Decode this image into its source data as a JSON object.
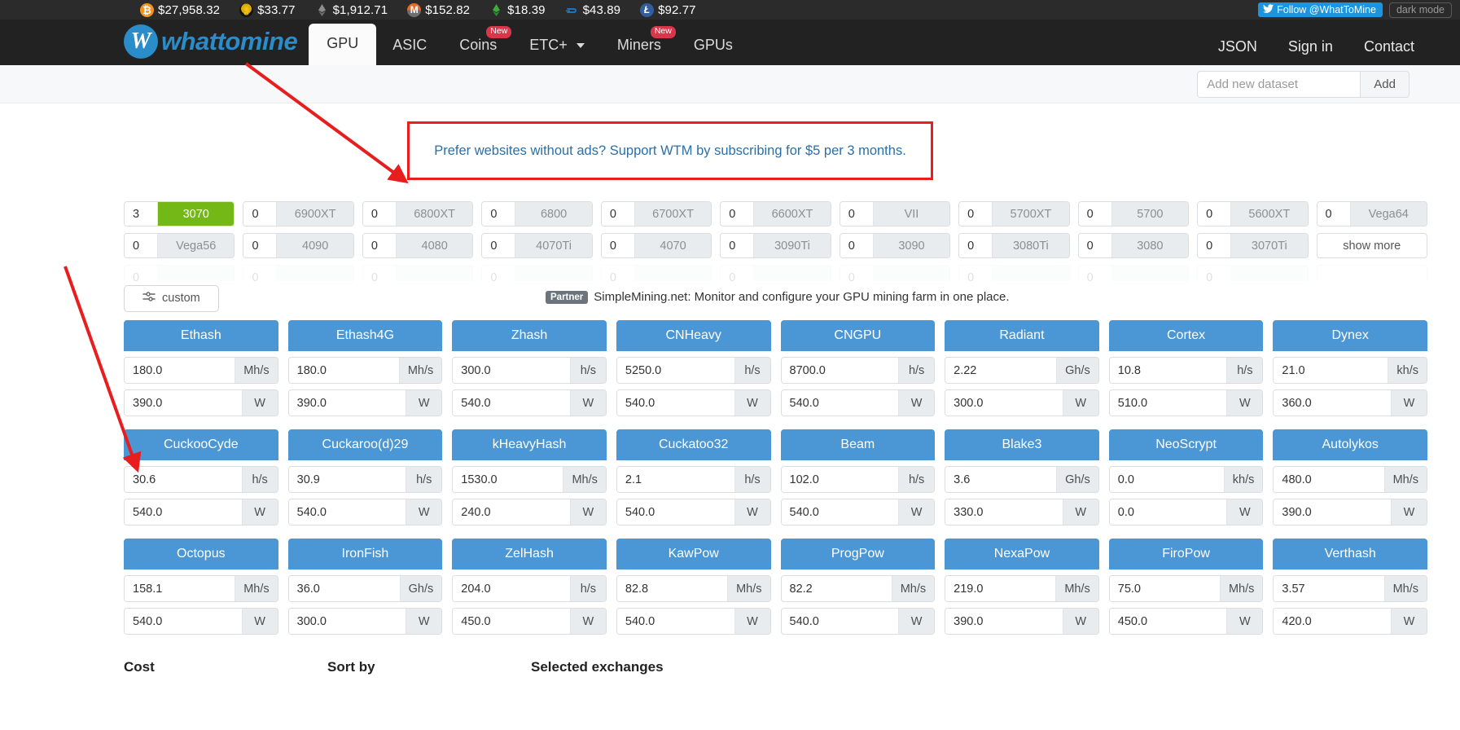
{
  "ticker": {
    "coins": [
      {
        "symbol": "BTC",
        "glyph": "₿",
        "icon": "bitcoin-icon",
        "price": "$27,958.32"
      },
      {
        "symbol": "ETC",
        "glyph": "ƺ",
        "icon": "ethereum-classic-icon",
        "price": "$33.77"
      },
      {
        "symbol": "ETH",
        "glyph": "",
        "icon": "ethereum-icon",
        "price": "$1,912.71"
      },
      {
        "symbol": "XMR",
        "glyph": "M",
        "icon": "monero-icon",
        "price": "$152.82"
      },
      {
        "symbol": "ETHW",
        "glyph": "",
        "icon": "ethereum-pow-icon",
        "price": "$18.39"
      },
      {
        "symbol": "DASH",
        "glyph": "D",
        "icon": "dash-icon",
        "price": "$43.89"
      },
      {
        "symbol": "LTC",
        "glyph": "Ł",
        "icon": "litecoin-icon",
        "price": "$92.77"
      }
    ],
    "twitter_follow": "Follow @WhatToMine",
    "dark_mode": "dark mode"
  },
  "brand": {
    "name": "whattomine",
    "logo_letter": "W",
    "accent_color": "#2a8cc8"
  },
  "nav": {
    "items": [
      {
        "label": "GPU",
        "active": true,
        "badge": null,
        "caret": false
      },
      {
        "label": "ASIC",
        "active": false,
        "badge": null,
        "caret": false
      },
      {
        "label": "Coins",
        "active": false,
        "badge": "New",
        "caret": false
      },
      {
        "label": "ETC+",
        "active": false,
        "badge": null,
        "caret": true
      },
      {
        "label": "Miners",
        "active": false,
        "badge": "New",
        "caret": false
      },
      {
        "label": "GPUs",
        "active": false,
        "badge": null,
        "caret": false
      }
    ],
    "right": [
      {
        "label": "JSON"
      },
      {
        "label": "Sign in"
      },
      {
        "label": "Contact"
      }
    ]
  },
  "dataset": {
    "placeholder": "Add new dataset",
    "value": "",
    "add_label": "Add"
  },
  "promo": {
    "text": "Prefer websites without ads? Support WTM by subscribing for $5 per 3 months.",
    "border_color": "#ee1c1c",
    "text_color": "#2a6fa8"
  },
  "gpus": {
    "row1": [
      {
        "qty": "3",
        "name": "3070",
        "selected": true
      },
      {
        "qty": "0",
        "name": "6900XT",
        "selected": false
      },
      {
        "qty": "0",
        "name": "6800XT",
        "selected": false
      },
      {
        "qty": "0",
        "name": "6800",
        "selected": false
      },
      {
        "qty": "0",
        "name": "6700XT",
        "selected": false
      },
      {
        "qty": "0",
        "name": "6600XT",
        "selected": false
      },
      {
        "qty": "0",
        "name": "VII",
        "selected": false
      },
      {
        "qty": "0",
        "name": "5700XT",
        "selected": false
      },
      {
        "qty": "0",
        "name": "5700",
        "selected": false
      },
      {
        "qty": "0",
        "name": "5600XT",
        "selected": false
      },
      {
        "qty": "0",
        "name": "Vega64",
        "selected": false
      }
    ],
    "row2": [
      {
        "qty": "0",
        "name": "Vega56",
        "selected": false
      },
      {
        "qty": "0",
        "name": "4090",
        "selected": false
      },
      {
        "qty": "0",
        "name": "4080",
        "selected": false
      },
      {
        "qty": "0",
        "name": "4070Ti",
        "selected": false
      },
      {
        "qty": "0",
        "name": "4070",
        "selected": false
      },
      {
        "qty": "0",
        "name": "3090Ti",
        "selected": false
      },
      {
        "qty": "0",
        "name": "3090",
        "selected": false
      },
      {
        "qty": "0",
        "name": "3080Ti",
        "selected": false
      },
      {
        "qty": "0",
        "name": "3080",
        "selected": false
      },
      {
        "qty": "0",
        "name": "3070Ti",
        "selected": false
      }
    ],
    "show_more_label": "show more",
    "custom_label": "custom",
    "custom_icon": "sliders-icon"
  },
  "partner": {
    "tag": "Partner",
    "text": "SimpleMining.net: Monitor and configure your GPU mining farm in one place."
  },
  "algorithms": [
    [
      {
        "name": "Ethash",
        "rate": "180.0",
        "rate_unit": "Mh/s",
        "power": "390.0",
        "power_unit": "W"
      },
      {
        "name": "Ethash4G",
        "rate": "180.0",
        "rate_unit": "Mh/s",
        "power": "390.0",
        "power_unit": "W"
      },
      {
        "name": "Zhash",
        "rate": "300.0",
        "rate_unit": "h/s",
        "power": "540.0",
        "power_unit": "W"
      },
      {
        "name": "CNHeavy",
        "rate": "5250.0",
        "rate_unit": "h/s",
        "power": "540.0",
        "power_unit": "W"
      },
      {
        "name": "CNGPU",
        "rate": "8700.0",
        "rate_unit": "h/s",
        "power": "540.0",
        "power_unit": "W"
      },
      {
        "name": "Radiant",
        "rate": "2.22",
        "rate_unit": "Gh/s",
        "power": "300.0",
        "power_unit": "W"
      },
      {
        "name": "Cortex",
        "rate": "10.8",
        "rate_unit": "h/s",
        "power": "510.0",
        "power_unit": "W"
      },
      {
        "name": "Dynex",
        "rate": "21.0",
        "rate_unit": "kh/s",
        "power": "360.0",
        "power_unit": "W"
      }
    ],
    [
      {
        "name": "CuckooCyde",
        "rate": "30.6",
        "rate_unit": "h/s",
        "power": "540.0",
        "power_unit": "W"
      },
      {
        "name": "Cuckaroo(d)29",
        "rate": "30.9",
        "rate_unit": "h/s",
        "power": "540.0",
        "power_unit": "W"
      },
      {
        "name": "kHeavyHash",
        "rate": "1530.0",
        "rate_unit": "Mh/s",
        "power": "240.0",
        "power_unit": "W"
      },
      {
        "name": "Cuckatoo32",
        "rate": "2.1",
        "rate_unit": "h/s",
        "power": "540.0",
        "power_unit": "W"
      },
      {
        "name": "Beam",
        "rate": "102.0",
        "rate_unit": "h/s",
        "power": "540.0",
        "power_unit": "W"
      },
      {
        "name": "Blake3",
        "rate": "3.6",
        "rate_unit": "Gh/s",
        "power": "330.0",
        "power_unit": "W"
      },
      {
        "name": "NeoScrypt",
        "rate": "0.0",
        "rate_unit": "kh/s",
        "power": "0.0",
        "power_unit": "W"
      },
      {
        "name": "Autolykos",
        "rate": "480.0",
        "rate_unit": "Mh/s",
        "power": "390.0",
        "power_unit": "W"
      }
    ],
    [
      {
        "name": "Octopus",
        "rate": "158.1",
        "rate_unit": "Mh/s",
        "power": "540.0",
        "power_unit": "W"
      },
      {
        "name": "IronFish",
        "rate": "36.0",
        "rate_unit": "Gh/s",
        "power": "300.0",
        "power_unit": "W"
      },
      {
        "name": "ZelHash",
        "rate": "204.0",
        "rate_unit": "h/s",
        "power": "450.0",
        "power_unit": "W"
      },
      {
        "name": "KawPow",
        "rate": "82.8",
        "rate_unit": "Mh/s",
        "power": "540.0",
        "power_unit": "W"
      },
      {
        "name": "ProgPow",
        "rate": "82.2",
        "rate_unit": "Mh/s",
        "power": "540.0",
        "power_unit": "W"
      },
      {
        "name": "NexaPow",
        "rate": "219.0",
        "rate_unit": "Mh/s",
        "power": "390.0",
        "power_unit": "W"
      },
      {
        "name": "FiroPow",
        "rate": "75.0",
        "rate_unit": "Mh/s",
        "power": "450.0",
        "power_unit": "W"
      },
      {
        "name": "Verthash",
        "rate": "3.57",
        "rate_unit": "Mh/s",
        "power": "420.0",
        "power_unit": "W"
      }
    ]
  ],
  "bottom": {
    "cost_label": "Cost",
    "sort_label": "Sort by",
    "exchanges_label": "Selected exchanges"
  }
}
